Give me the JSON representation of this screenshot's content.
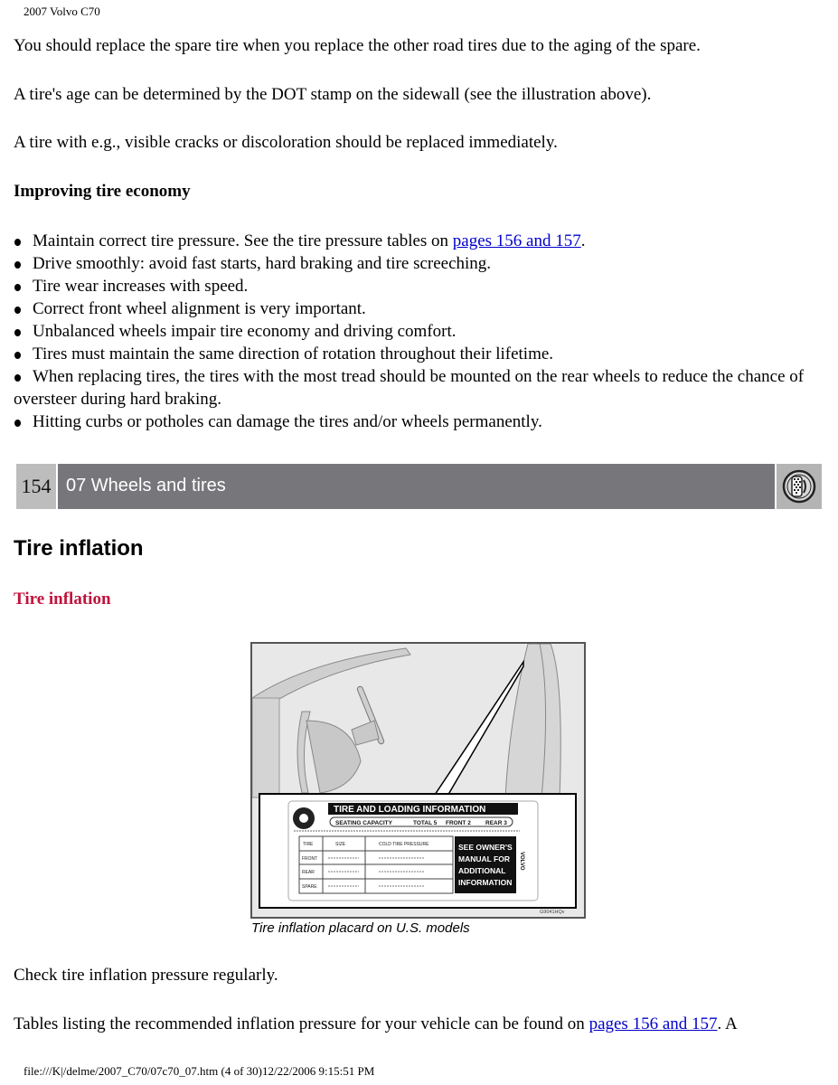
{
  "document": {
    "title": "2007 Volvo C70"
  },
  "paragraphs_top": [
    "You should replace the spare tire when you replace the other road tires due to the aging of the spare.",
    "A tire's age can be determined by the DOT stamp on the sidewall (see the illustration above).",
    "A tire with e.g., visible cracks or discoloration should be replaced immediately."
  ],
  "economy": {
    "heading": "Improving tire economy",
    "bullets": [
      {
        "text": "Maintain correct tire pressure. See the tire pressure tables on ",
        "link": "pages 156 and 157",
        "after": "."
      },
      {
        "text": "Drive smoothly: avoid fast starts, hard braking and tire screeching."
      },
      {
        "text": "Tire wear increases with speed."
      },
      {
        "text": "Correct front wheel alignment is very important."
      },
      {
        "text": "Unbalanced wheels impair tire economy and driving comfort."
      },
      {
        "text": "Tires must maintain the same direction of rotation throughout their lifetime."
      },
      {
        "text": "When replacing tires, the tires with the most tread should be mounted on the rear wheels to reduce the chance of oversteer during hard braking."
      },
      {
        "text": "Hitting curbs or potholes can damage the tires and/or wheels permanently."
      }
    ]
  },
  "banner": {
    "page_number": "154",
    "chapter": "07 Wheels and tires",
    "icon": "tire-icon"
  },
  "section": {
    "title": "Tire inflation",
    "subtitle": "Tire inflation"
  },
  "figure": {
    "placard_title": "TIRE AND LOADING INFORMATION",
    "seating_row": [
      "SEATING CAPACITY",
      "TOTAL 5",
      "FRONT 2",
      "REAR 3"
    ],
    "table_headers": [
      "TIRE",
      "SIZE",
      "COLD TIRE PRESSURE"
    ],
    "table_rows": [
      "FRONT",
      "REAR",
      "SPARE"
    ],
    "notice": [
      "SEE OWNER'S",
      "MANUAL FOR",
      "ADDITIONAL",
      "INFORMATION"
    ],
    "brand_vertical": "VOLVO",
    "code": "G9041HQv",
    "caption": "Tire inflation placard on U.S. models"
  },
  "paragraphs_bottom": [
    {
      "text": "Check tire inflation pressure regularly."
    },
    {
      "text": "Tables listing the recommended inflation pressure for your vehicle can be found on ",
      "link": "pages 156 and 157",
      "after": ". A"
    }
  ],
  "footer": {
    "text": "file:///K|/delme/2007_C70/07c70_07.htm (4 of 30)12/22/2006 9:15:51 PM"
  },
  "colors": {
    "link": "#0000cc",
    "subtitle": "#c0143c",
    "banner_chapter_bg": "#77777b",
    "banner_page_bg": "#bdbdbd"
  }
}
